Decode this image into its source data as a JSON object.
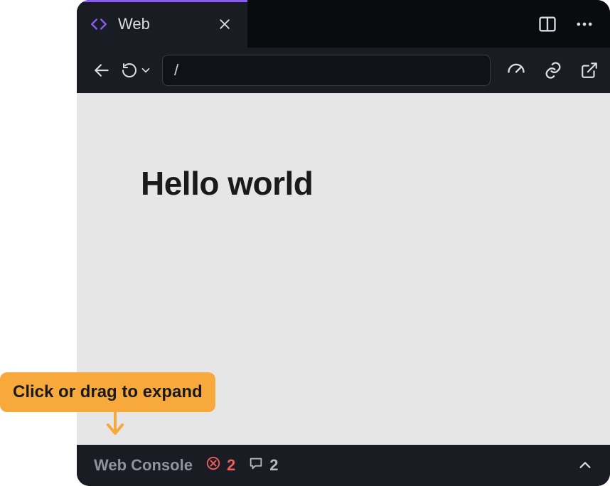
{
  "tab": {
    "title": "Web"
  },
  "url": {
    "value": "/"
  },
  "page": {
    "heading": "Hello world"
  },
  "console": {
    "title": "Web Console",
    "errors": "2",
    "messages": "2"
  },
  "tooltip": {
    "text": "Click or drag to expand"
  }
}
